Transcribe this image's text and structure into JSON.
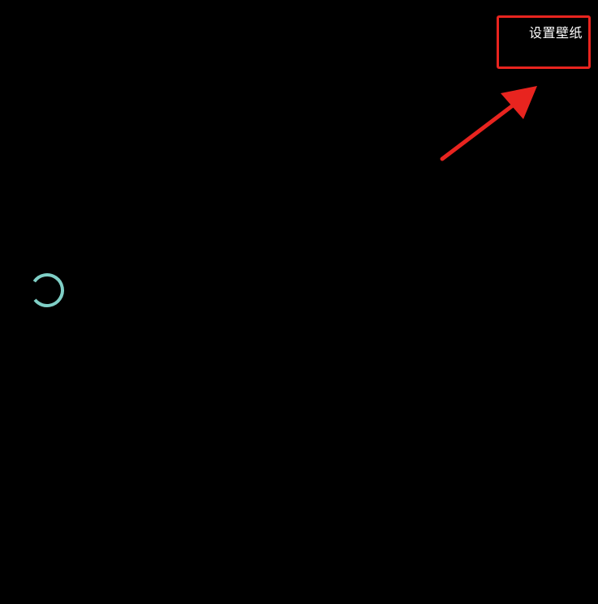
{
  "toolbar": {
    "set_wallpaper_label": "设置壁纸"
  },
  "colors": {
    "background": "#000000",
    "spinner": "#7fcfc6",
    "annotation": "#e8241f",
    "label": "#ffffff"
  },
  "icons": {
    "spinner": "loading-spinner-icon",
    "arrow": "arrow-annotation"
  }
}
